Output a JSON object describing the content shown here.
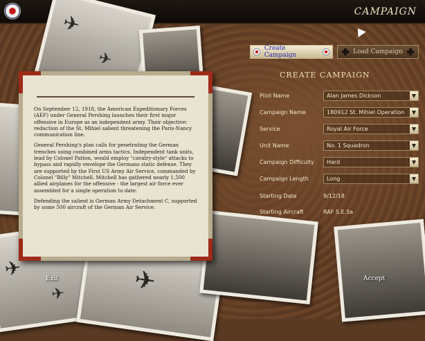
{
  "window": {
    "title": "CAMPAIGN"
  },
  "tabs": {
    "create_label": "Create Campaign",
    "load_label": "Load Campaign"
  },
  "form": {
    "heading": "CREATE CAMPAIGN",
    "fields": [
      {
        "label": "Pilot Name",
        "value": "Alan James Dickson"
      },
      {
        "label": "Campaign Name",
        "value": "180912 St. Mihiel Operation"
      },
      {
        "label": "Service",
        "value": "Royal Air Force"
      },
      {
        "label": "Unit Name",
        "value": "No. 1 Squadron"
      },
      {
        "label": "Campaign Difficulty",
        "value": "Hard"
      },
      {
        "label": "Campaign Length",
        "value": "Long"
      }
    ],
    "static": [
      {
        "label": "Starting Date",
        "value": "9/12/18"
      },
      {
        "label": "Starting Aircraft",
        "value": "RAF S.E.5a"
      }
    ]
  },
  "briefing": {
    "paragraphs": [
      "On September 12, 1918, the American Expeditionary Forces (AEF) under General Pershing launches their first major offensive in Europe as an independent army. Their objective: reduction of the St. Mihiel salient threatening the Paris-Nancy communication line.",
      "General Pershing's plan calls for penetrating the German trenches using combined arms tactics. Independent tank units, lead by Colonel Patton, would employ \"cavalry-style\" attacks to bypass and rapidly envelope the Germans static defense. They are supported by the First US Army Air Service, commanded by Colonel \"Billy\" Mitchell. Mitchell has gathered nearly 1,500 allied airplanes for the offensive - the largest air force ever assembled for a single operation to date.",
      "Defending the salient is German Army Detachment C, supported by some 500 aircraft of the German Air Service."
    ]
  },
  "nav": {
    "exit_label": "Exit",
    "accept_label": "Accept"
  },
  "colors": {
    "accent_red": "#9e2a1a",
    "text_light": "#f2e8cc",
    "link_blue": "#2a2ab0"
  }
}
